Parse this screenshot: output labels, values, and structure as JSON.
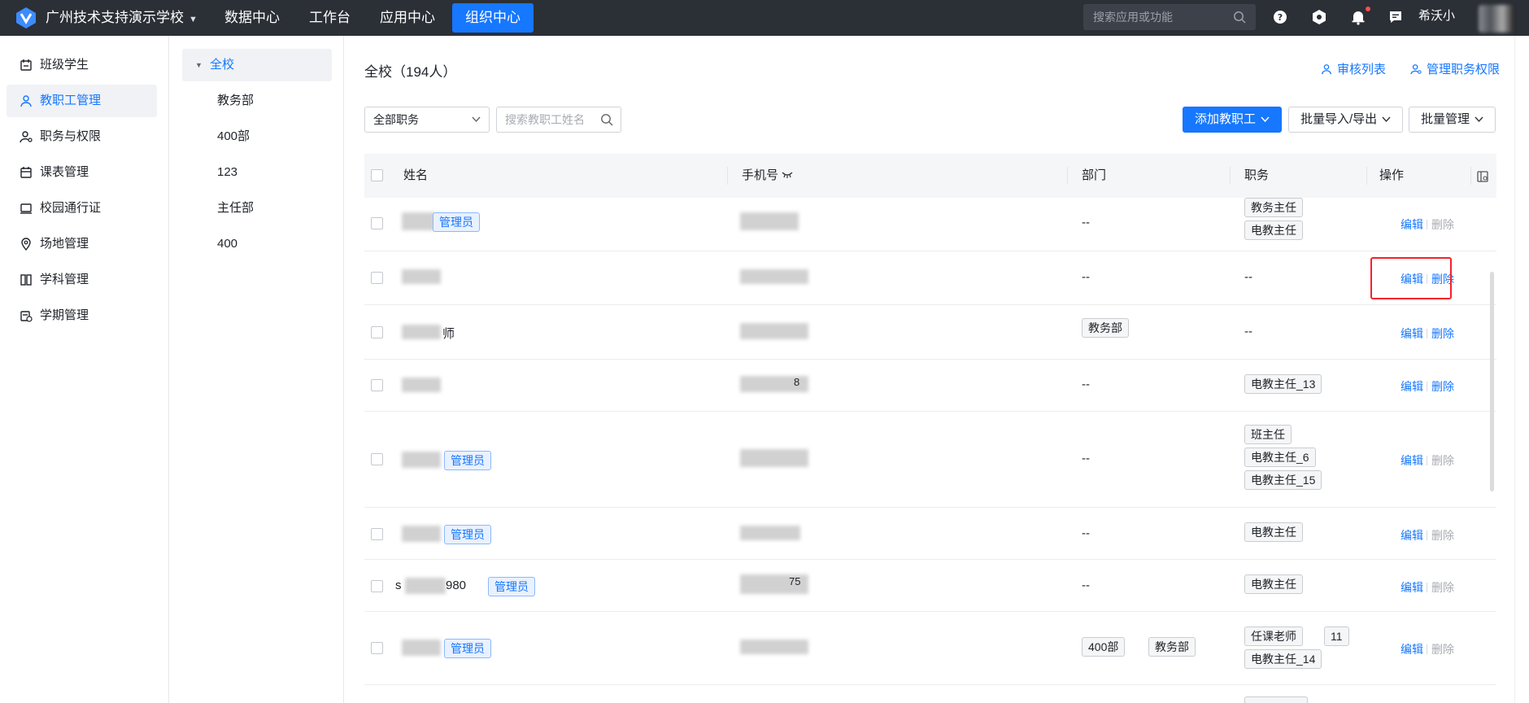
{
  "topbar": {
    "school_name": "广州技术支持演示学校",
    "nav": [
      "数据中心",
      "工作台",
      "应用中心",
      "组织中心"
    ],
    "active_nav": "组织中心",
    "search_placeholder": "搜索应用或功能",
    "user_name": "希沃小",
    "colors": {
      "bar": "#2b2f36",
      "accent": "#1677ff"
    }
  },
  "sidebar": {
    "items": [
      {
        "label": "班级学生",
        "icon": "class-students-icon"
      },
      {
        "label": "教职工管理",
        "icon": "user-icon",
        "active": true
      },
      {
        "label": "职务与权限",
        "icon": "user-permission-icon"
      },
      {
        "label": "课表管理",
        "icon": "calendar-icon"
      },
      {
        "label": "校园通行证",
        "icon": "pass-card-icon"
      },
      {
        "label": "场地管理",
        "icon": "location-pin-icon"
      },
      {
        "label": "学科管理",
        "icon": "book-icon"
      },
      {
        "label": "学期管理",
        "icon": "semester-calendar-icon"
      }
    ]
  },
  "tree": {
    "root": "全校",
    "children": [
      "教务部",
      "400部",
      "123",
      "主任部",
      "400"
    ]
  },
  "main": {
    "title": "全校（194人）",
    "links": {
      "review_list": "审核列表",
      "manage_perm": "管理职务权限"
    },
    "filters": {
      "position_select": "全部职务",
      "search_placeholder": "搜索教职工姓名"
    },
    "buttons": {
      "add": "添加教职工",
      "import_export": "批量导入/导出",
      "batch_manage": "批量管理"
    },
    "columns": {
      "name": "姓名",
      "phone": "手机号",
      "dept": "部门",
      "position": "职务",
      "action": "操作"
    },
    "admin_label": "管理员",
    "actions": {
      "edit": "编辑",
      "delete": "删除"
    },
    "empty": "--",
    "rows": [
      {
        "name_suffix": "",
        "admin": true,
        "phone_suffix": "",
        "depts": [],
        "positions": [
          "教务主任",
          "电教主任"
        ],
        "delete_enabled": false
      },
      {
        "name_suffix": "",
        "admin": false,
        "phone_suffix": "",
        "depts": [],
        "positions": [],
        "delete_enabled": true
      },
      {
        "name_suffix": "师",
        "admin": false,
        "phone_suffix": "",
        "depts": [
          "教务部"
        ],
        "positions": [],
        "delete_enabled": true
      },
      {
        "name_suffix": "",
        "admin": false,
        "phone_suffix": "8",
        "depts": [],
        "positions": [
          "电教主任_13"
        ],
        "delete_enabled": true
      },
      {
        "name_suffix": "",
        "admin": true,
        "phone_suffix": "",
        "depts": [],
        "positions": [
          "班主任",
          "电教主任_6",
          "电教主任_15"
        ],
        "delete_enabled": false
      },
      {
        "name_suffix": "",
        "admin": true,
        "phone_suffix": "",
        "depts": [],
        "positions": [
          "电教主任"
        ],
        "delete_enabled": false
      },
      {
        "name_prefix": "s",
        "name_suffix": "980",
        "admin": true,
        "phone_suffix": "75",
        "depts": [],
        "positions": [
          "电教主任"
        ],
        "delete_enabled": false
      },
      {
        "name_suffix": "",
        "admin": true,
        "phone_suffix": "",
        "depts": [
          "400部",
          "教务部"
        ],
        "positions": [
          "任课老师",
          "11",
          "电教主任_14"
        ],
        "delete_enabled": false
      }
    ]
  }
}
